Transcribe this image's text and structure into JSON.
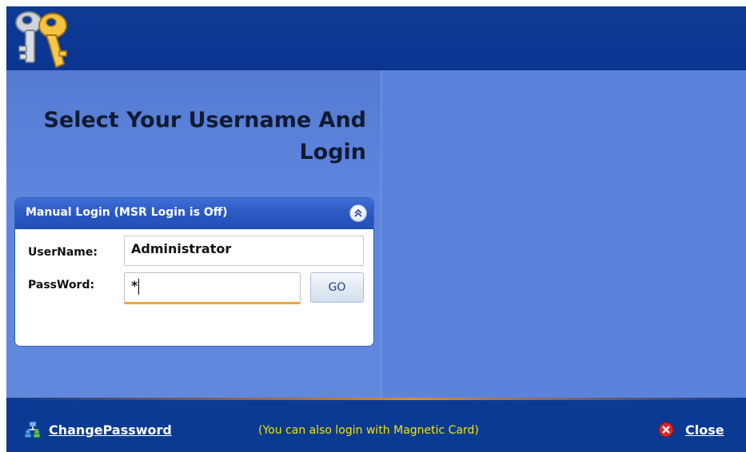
{
  "header": {
    "icon": "keys-icon"
  },
  "main": {
    "heading_line1": "Select Your Username And",
    "heading_line2": "Login"
  },
  "login_panel": {
    "title": "Manual Login (MSR Login is Off)",
    "collapse_icon": "double-chevron-up-icon",
    "username_label": "UserName:",
    "username_value": "Administrator",
    "password_label": "PassWord:",
    "password_value": "*",
    "go_label": "GO"
  },
  "footer": {
    "change_password_icon": "network-users-icon",
    "change_password_label": "ChangePassword",
    "note": "(You can also login with Magnetic Card)",
    "close_icon": "close-icon",
    "close_label": "Close"
  },
  "colors": {
    "header_bar": "#0e3b94",
    "body_background": "#5b81d9",
    "panel_header": "#2a57c1",
    "accent_orange": "#f0a63a",
    "note_yellow": "#f2e400",
    "close_red": "#d9262b"
  }
}
